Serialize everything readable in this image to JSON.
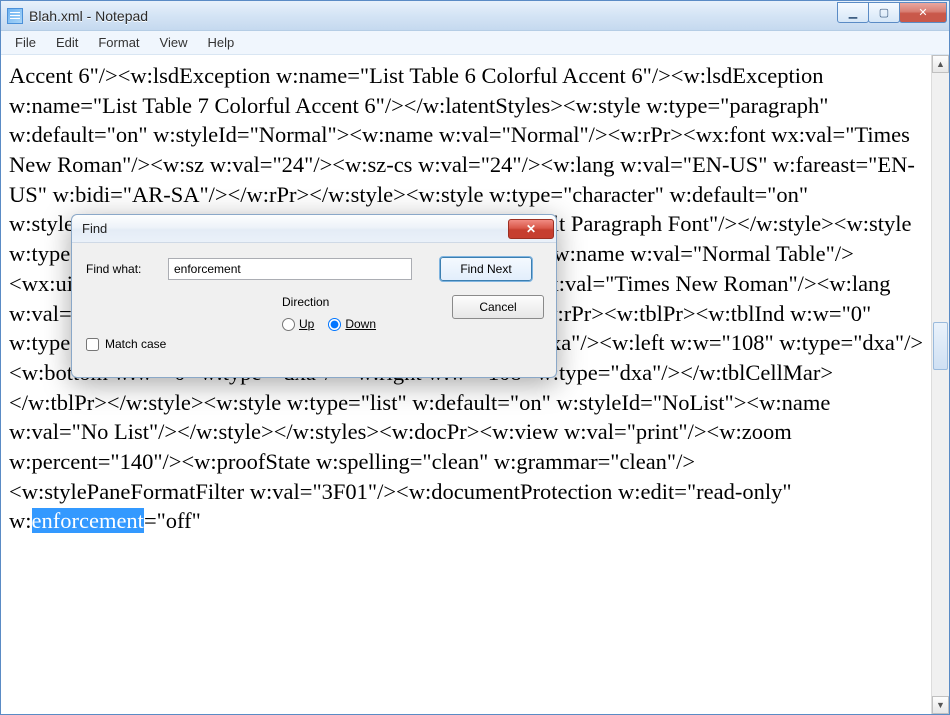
{
  "window": {
    "title": "Blah.xml - Notepad",
    "controls": {
      "min": "▁",
      "max": "▢",
      "close": "✕"
    }
  },
  "menu": {
    "file": "File",
    "edit": "Edit",
    "format": "Format",
    "view": "View",
    "help": "Help"
  },
  "editor": {
    "text_before_highlight": "Accent 6\"/><w:lsdException w:name=\"List Table 6 Colorful Accent 6\"/><w:lsdException w:name=\"List Table 7 Colorful Accent 6\"/></w:latentStyles><w:style w:type=\"paragraph\" w:default=\"on\" w:styleId=\"Normal\"><w:name w:val=\"Normal\"/><w:rPr><wx:font wx:val=\"Times New Roman\"/><w:sz w:val=\"24\"/><w:sz-cs w:val=\"24\"/><w:lang w:val=\"EN-US\" w:fareast=\"EN-US\" w:bidi=\"AR-SA\"/></w:rPr></w:style><w:style w:type=\"character\" w:default=\"on\" w:styleId=\"DefaultParagraphFont\"><w:name w:val=\"Default Paragraph Font\"/></w:style><w:style w:type=\"table\" w:default=\"on\" w:styleId=\"NormalTable\"><w:name w:val=\"Normal Table\"/><wx:uiName wx:val=\"Table Normal\"/><w:rPr><wx:font wx:val=\"Times New Roman\"/><w:lang w:val=\"EN-US\" w:fareast=\"EN-US\" w:bidi=\"AR-SA\"/></w:rPr><w:tblPr><w:tblInd w:w=\"0\" w:type=\"dxa\"/><w:tblCellMar><w:top w:w=\"0\" w:type=\"dxa\"/><w:left w:w=\"108\" w:type=\"dxa\"/><w:bottom w:w=\"0\" w:type=\"dxa\"/><w:right w:w=\"108\" w:type=\"dxa\"/></w:tblCellMar></w:tblPr></w:style><w:style w:type=\"list\" w:default=\"on\" w:styleId=\"NoList\"><w:name w:val=\"No List\"/></w:style></w:styles><w:docPr><w:view w:val=\"print\"/><w:zoom w:percent=\"140\"/><w:proofState w:spelling=\"clean\" w:grammar=\"clean\"/><w:stylePaneFormatFilter w:val=\"3F01\"/><w:documentProtection w:edit=\"read-only\" w:",
    "highlighted": "enforcement",
    "text_after_highlight": "=\"off\""
  },
  "find_dialog": {
    "title": "Find",
    "find_what_label": "Find what:",
    "find_what_value": "enforcement",
    "find_next": "Find Next",
    "cancel": "Cancel",
    "match_case": "Match case",
    "direction_label": "Direction",
    "up": "Up",
    "down": "Down",
    "direction_selected": "down"
  }
}
